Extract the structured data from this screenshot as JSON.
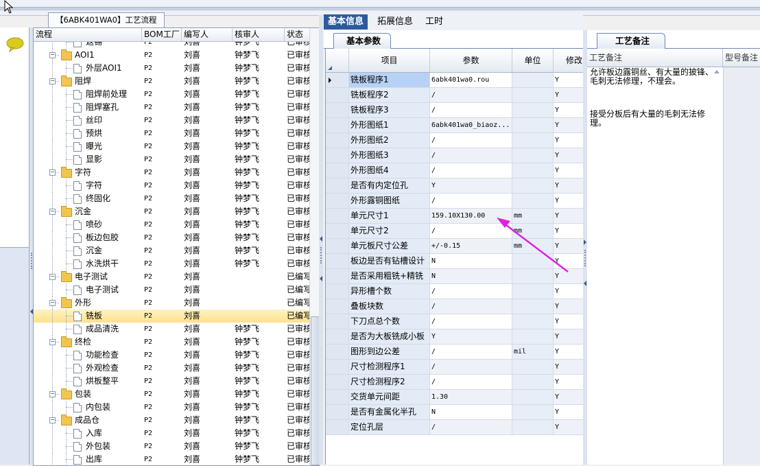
{
  "tree_panel": {
    "tab_title": "【6ABK401WA0】工艺流程",
    "columns": [
      "流程",
      "BOM工厂",
      "编写人",
      "核审人",
      "状态"
    ],
    "rows": [
      {
        "name": "返锡",
        "level": 2,
        "kind": "doc",
        "factory": "P2",
        "writer": "刘喜",
        "reviewer": "钟梦飞",
        "status": "已审核",
        "partial": true
      },
      {
        "name": "AOI1",
        "level": 1,
        "kind": "folder",
        "factory": "P2",
        "writer": "刘喜",
        "reviewer": "钟梦飞",
        "status": "已审核"
      },
      {
        "name": "外层AOI1",
        "level": 2,
        "kind": "doc",
        "factory": "P2",
        "writer": "刘喜",
        "reviewer": "钟梦飞",
        "status": "已审核"
      },
      {
        "name": "阻焊",
        "level": 1,
        "kind": "folder",
        "factory": "P2",
        "writer": "刘喜",
        "reviewer": "钟梦飞",
        "status": "已审核"
      },
      {
        "name": "阻焊前处理",
        "level": 2,
        "kind": "doc",
        "factory": "P2",
        "writer": "刘喜",
        "reviewer": "钟梦飞",
        "status": "已审核"
      },
      {
        "name": "阻焊塞孔",
        "level": 2,
        "kind": "doc",
        "factory": "P2",
        "writer": "刘喜",
        "reviewer": "钟梦飞",
        "status": "已审核"
      },
      {
        "name": "丝印",
        "level": 2,
        "kind": "doc",
        "factory": "P2",
        "writer": "刘喜",
        "reviewer": "钟梦飞",
        "status": "已审核"
      },
      {
        "name": "预烘",
        "level": 2,
        "kind": "doc",
        "factory": "P2",
        "writer": "刘喜",
        "reviewer": "钟梦飞",
        "status": "已审核"
      },
      {
        "name": "曝光",
        "level": 2,
        "kind": "doc",
        "factory": "P2",
        "writer": "刘喜",
        "reviewer": "钟梦飞",
        "status": "已审核"
      },
      {
        "name": "显影",
        "level": 2,
        "kind": "doc",
        "factory": "P2",
        "writer": "刘喜",
        "reviewer": "钟梦飞",
        "status": "已审核"
      },
      {
        "name": "字符",
        "level": 1,
        "kind": "folder",
        "factory": "P2",
        "writer": "刘喜",
        "reviewer": "钟梦飞",
        "status": "已审核"
      },
      {
        "name": "字符",
        "level": 2,
        "kind": "doc",
        "factory": "P2",
        "writer": "刘喜",
        "reviewer": "钟梦飞",
        "status": "已审核"
      },
      {
        "name": "终固化",
        "level": 2,
        "kind": "doc",
        "factory": "P2",
        "writer": "刘喜",
        "reviewer": "钟梦飞",
        "status": "已审核"
      },
      {
        "name": "沉金",
        "level": 1,
        "kind": "folder",
        "factory": "P2",
        "writer": "刘喜",
        "reviewer": "钟梦飞",
        "status": "已审核"
      },
      {
        "name": "喷砂",
        "level": 2,
        "kind": "doc",
        "factory": "P2",
        "writer": "刘喜",
        "reviewer": "钟梦飞",
        "status": "已审核"
      },
      {
        "name": "板边包胶",
        "level": 2,
        "kind": "doc",
        "factory": "P2",
        "writer": "刘喜",
        "reviewer": "钟梦飞",
        "status": "已审核"
      },
      {
        "name": "沉金",
        "level": 2,
        "kind": "doc",
        "factory": "P2",
        "writer": "刘喜",
        "reviewer": "钟梦飞",
        "status": "已审核"
      },
      {
        "name": "水洗烘干",
        "level": 2,
        "kind": "doc",
        "factory": "P2",
        "writer": "刘喜",
        "reviewer": "钟梦飞",
        "status": "已审核"
      },
      {
        "name": "电子测试",
        "level": 1,
        "kind": "folder",
        "factory": "P2",
        "writer": "刘喜",
        "reviewer": "",
        "status": "已编写"
      },
      {
        "name": "电子测试",
        "level": 2,
        "kind": "doc",
        "factory": "P2",
        "writer": "刘喜",
        "reviewer": "",
        "status": "已编写"
      },
      {
        "name": "外形",
        "level": 1,
        "kind": "folder",
        "factory": "P2",
        "writer": "刘喜",
        "reviewer": "",
        "status": "已编写"
      },
      {
        "name": "铣板",
        "level": 2,
        "kind": "doc",
        "factory": "P2",
        "writer": "刘喜",
        "reviewer": "",
        "status": "已编写",
        "selected": true
      },
      {
        "name": "成品清洗",
        "level": 2,
        "kind": "doc",
        "factory": "P2",
        "writer": "刘喜",
        "reviewer": "钟梦飞",
        "status": "已审核"
      },
      {
        "name": "终检",
        "level": 1,
        "kind": "folder",
        "factory": "P2",
        "writer": "刘喜",
        "reviewer": "钟梦飞",
        "status": "已审核"
      },
      {
        "name": "功能检查",
        "level": 2,
        "kind": "doc",
        "factory": "P2",
        "writer": "刘喜",
        "reviewer": "钟梦飞",
        "status": "已审核"
      },
      {
        "name": "外观检查",
        "level": 2,
        "kind": "doc",
        "factory": "P2",
        "writer": "刘喜",
        "reviewer": "钟梦飞",
        "status": "已审核"
      },
      {
        "name": "烘板整平",
        "level": 2,
        "kind": "doc",
        "factory": "P2",
        "writer": "刘喜",
        "reviewer": "钟梦飞",
        "status": "已审核"
      },
      {
        "name": "包装",
        "level": 1,
        "kind": "folder",
        "factory": "P2",
        "writer": "刘喜",
        "reviewer": "钟梦飞",
        "status": "已审核"
      },
      {
        "name": "内包装",
        "level": 2,
        "kind": "doc",
        "factory": "P2",
        "writer": "刘喜",
        "reviewer": "钟梦飞",
        "status": "已审核"
      },
      {
        "name": "成品仓",
        "level": 1,
        "kind": "folder",
        "factory": "P2",
        "writer": "刘喜",
        "reviewer": "钟梦飞",
        "status": "已审核"
      },
      {
        "name": "入库",
        "level": 2,
        "kind": "doc",
        "factory": "P2",
        "writer": "刘喜",
        "reviewer": "钟梦飞",
        "status": "已审核"
      },
      {
        "name": "外包装",
        "level": 2,
        "kind": "doc",
        "factory": "P2",
        "writer": "刘喜",
        "reviewer": "钟梦飞",
        "status": "已审核"
      },
      {
        "name": "出库",
        "level": 2,
        "kind": "doc",
        "factory": "P2",
        "writer": "刘喜",
        "reviewer": "钟梦飞",
        "status": "已审核"
      }
    ]
  },
  "main_tabs": [
    "基本信息",
    "拓展信息",
    "工时"
  ],
  "active_main_tab": 0,
  "sub_tab": "基本参数",
  "grid": {
    "columns": [
      "项目",
      "参数",
      "单位",
      "修改"
    ],
    "current_row": 0,
    "rows": [
      {
        "item": "铣板程序1",
        "param": "6abk401wa0.rou",
        "unit": "",
        "mod": "Y"
      },
      {
        "item": "铣板程序2",
        "param": "/",
        "unit": "",
        "mod": "Y"
      },
      {
        "item": "铣板程序3",
        "param": "/",
        "unit": "",
        "mod": "Y"
      },
      {
        "item": "外形图纸1",
        "param": "6abk401wa0_biaoz...",
        "unit": "",
        "mod": "Y"
      },
      {
        "item": "外形图纸2",
        "param": "/",
        "unit": "",
        "mod": "Y"
      },
      {
        "item": "外形图纸3",
        "param": "/",
        "unit": "",
        "mod": "Y"
      },
      {
        "item": "外形图纸4",
        "param": "/",
        "unit": "",
        "mod": "Y"
      },
      {
        "item": "是否有内定位孔",
        "param": "Y",
        "unit": "",
        "mod": "Y"
      },
      {
        "item": "外形露铜图纸",
        "param": "/",
        "unit": "",
        "mod": "Y"
      },
      {
        "item": "单元尺寸1",
        "param": "159.10X130.00",
        "unit": "mm",
        "mod": "Y"
      },
      {
        "item": "单元尺寸2",
        "param": "/",
        "unit": "mm",
        "mod": "Y"
      },
      {
        "item": "单元板尺寸公差",
        "param": "+/-0.15",
        "unit": "mm",
        "mod": "Y"
      },
      {
        "item": "板边是否有钻槽设计",
        "param": "N",
        "unit": "",
        "mod": "Y"
      },
      {
        "item": "是否采用粗铣+精铣",
        "param": "N",
        "unit": "",
        "mod": "Y"
      },
      {
        "item": "异形槽个数",
        "param": "/",
        "unit": "",
        "mod": "Y"
      },
      {
        "item": "叠板块数",
        "param": "/",
        "unit": "",
        "mod": "Y"
      },
      {
        "item": "下刀点总个数",
        "param": "/",
        "unit": "",
        "mod": "Y"
      },
      {
        "item": "是否为大板铣成小板",
        "param": "Y",
        "unit": "",
        "mod": "Y"
      },
      {
        "item": "图形到边公差",
        "param": "/",
        "unit": "mil",
        "mod": "Y"
      },
      {
        "item": "尺寸检测程序1",
        "param": "/",
        "unit": "",
        "mod": "Y"
      },
      {
        "item": "尺寸检测程序2",
        "param": "/",
        "unit": "",
        "mod": "Y"
      },
      {
        "item": "交货单元间距",
        "param": "1.30",
        "unit": "",
        "mod": "Y"
      },
      {
        "item": "是否有金属化半孔",
        "param": "N",
        "unit": "",
        "mod": "Y"
      },
      {
        "item": "定位孔层",
        "param": "/",
        "unit": "",
        "mod": "Y"
      }
    ]
  },
  "remarks": {
    "tab_title": "工艺备注",
    "columns": [
      "工艺备注",
      "型号备注"
    ],
    "text1": "允许板边露铜丝、有大量的披锋、毛刺无法修理，不理会。",
    "text2": "接受分板后有大量的毛刺无法修理。"
  },
  "colors": {
    "accent": "#2d5a9c",
    "selection": "#fde18a",
    "annotation_arrow": "#e020e0"
  }
}
